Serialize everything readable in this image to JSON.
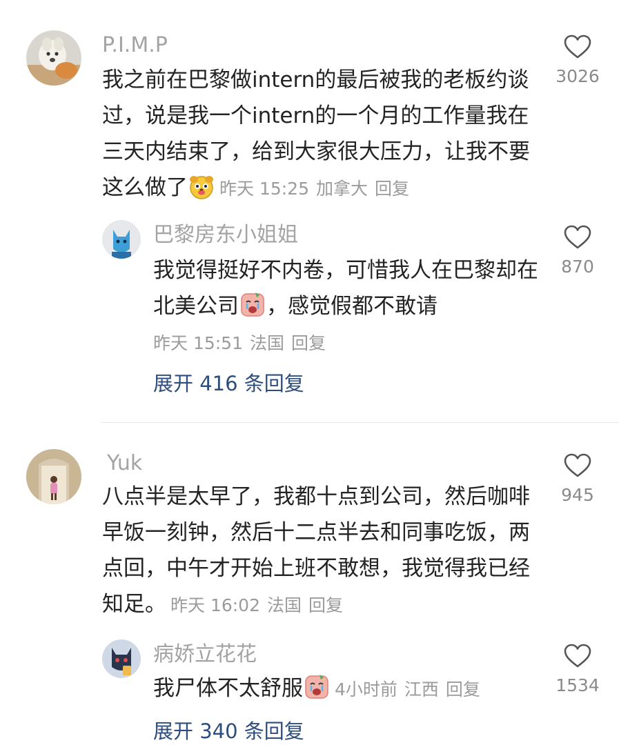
{
  "comments": [
    {
      "username": "P.I.M.P",
      "text": "我之前在巴黎做intern的最后被我的老板约谈过，说是我一个intern的一个月的工作量我在三天内结束了，给到大家很大压力，让我不要这么做了",
      "time": "昨天 15:25",
      "location": "加拿大",
      "reply_label": "回复",
      "likes": "3026",
      "emoji": "dog-face-emoji",
      "reply": {
        "username": "巴黎房东小姐姐",
        "text_before_emoji": "我觉得挺好不内卷，可惜我人在巴黎却在北美公司",
        "text_after_emoji": "，感觉假都不敢请",
        "time": "昨天 15:51",
        "location": "法国",
        "reply_label": "回复",
        "likes": "870"
      },
      "expand_label": "展开 416 条回复"
    },
    {
      "username": "Yuk",
      "text": "八点半是太早了，我都十点到公司，然后咖啡早饭一刻钟，然后十二点半去和同事吃饭，两点回，中午才开始上班不敢想，我觉得我已经知足。",
      "time": "昨天 16:02",
      "location": "法国",
      "reply_label": "回复",
      "likes": "945",
      "reply": {
        "username": "病娇立花花",
        "text": "我尸体不太舒服",
        "time": "4小时前",
        "location": "江西",
        "reply_label": "回复",
        "likes": "1534"
      },
      "expand_label": "展开 340 条回复"
    }
  ],
  "icons": {
    "like": "heart-outline-icon",
    "sad_emoji": "crying-face-emoji"
  },
  "colors": {
    "username": "#a3a3a3",
    "meta": "#9b9b9b",
    "expand_link": "#2c4d7e"
  }
}
